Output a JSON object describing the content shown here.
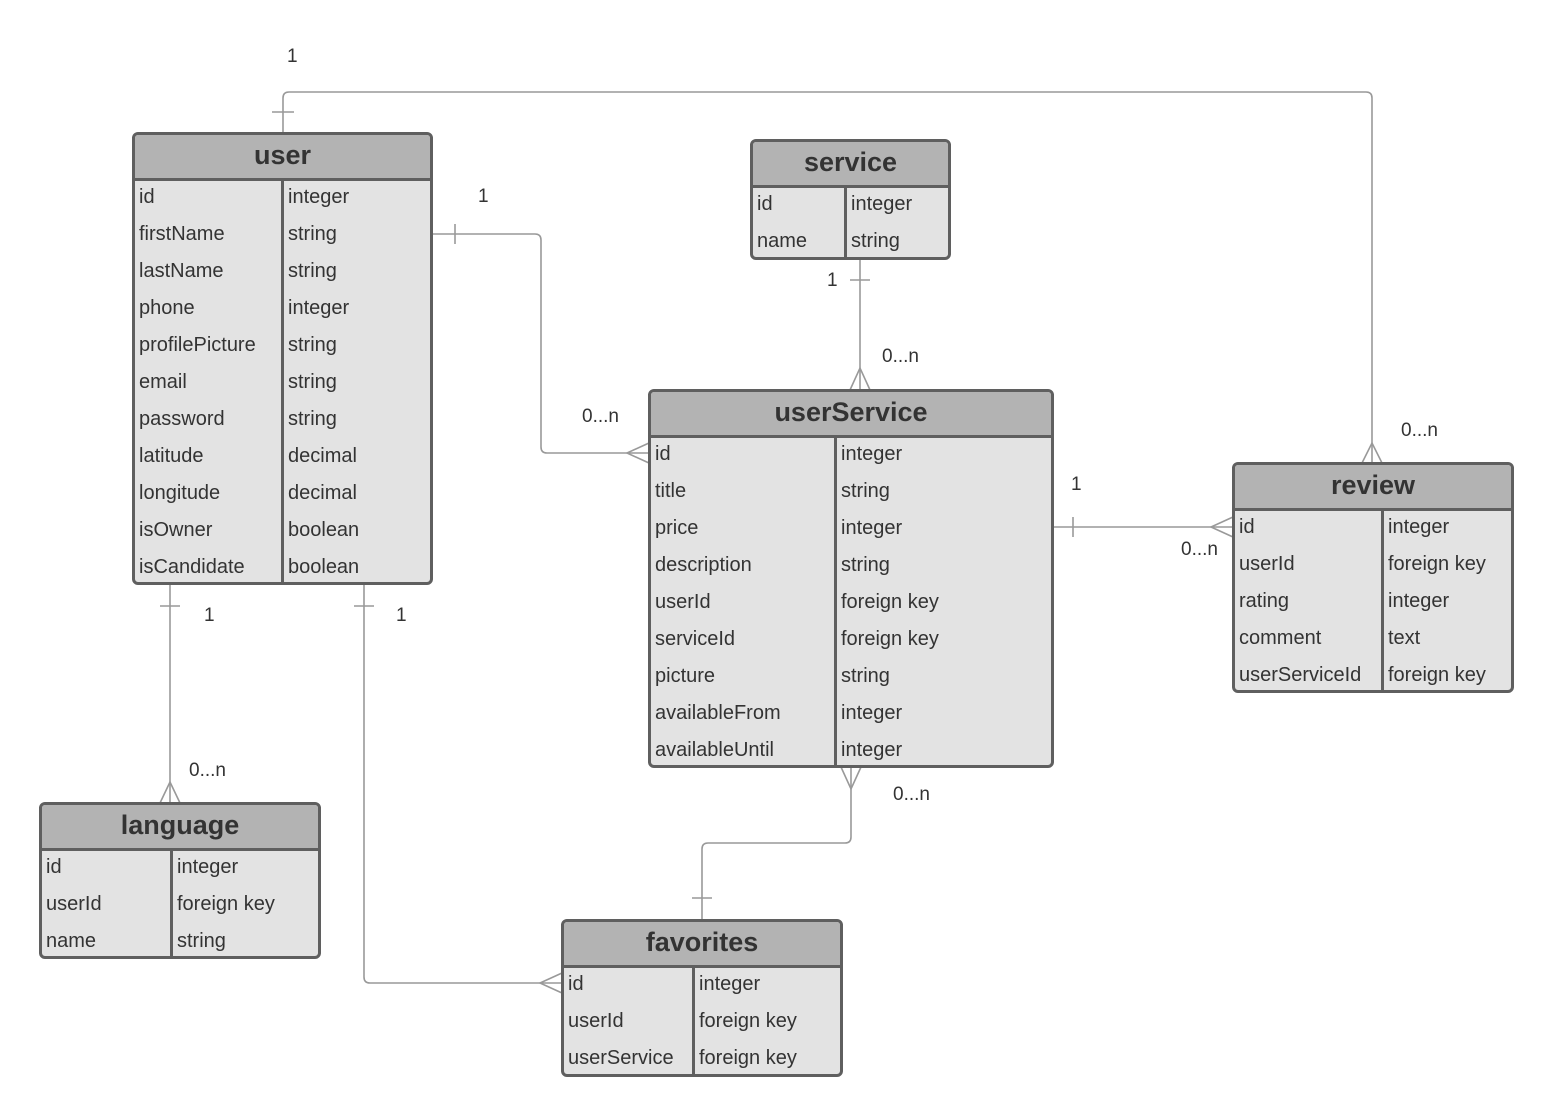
{
  "colors": {
    "header_fill": "#b3b3b3",
    "body_fill": "#e3e3e3",
    "border": "#5f5f5f",
    "connector": "#999999",
    "text": "#333333"
  },
  "entities": {
    "user": {
      "title": "user",
      "rows": [
        {
          "name": "id",
          "type": "integer"
        },
        {
          "name": "firstName",
          "type": "string"
        },
        {
          "name": "lastName",
          "type": "string"
        },
        {
          "name": "phone",
          "type": "integer"
        },
        {
          "name": "profilePicture",
          "type": "string"
        },
        {
          "name": "email",
          "type": "string"
        },
        {
          "name": "password",
          "type": "string"
        },
        {
          "name": "latitude",
          "type": "decimal"
        },
        {
          "name": "longitude",
          "type": "decimal"
        },
        {
          "name": "isOwner",
          "type": "boolean"
        },
        {
          "name": "isCandidate",
          "type": "boolean"
        }
      ]
    },
    "service": {
      "title": "service",
      "rows": [
        {
          "name": "id",
          "type": "integer"
        },
        {
          "name": "name",
          "type": "string"
        }
      ]
    },
    "userService": {
      "title": "userService",
      "rows": [
        {
          "name": "id",
          "type": "integer"
        },
        {
          "name": "title",
          "type": "string"
        },
        {
          "name": "price",
          "type": "integer"
        },
        {
          "name": "description",
          "type": "string"
        },
        {
          "name": "userId",
          "type": "foreign key"
        },
        {
          "name": "serviceId",
          "type": "foreign key"
        },
        {
          "name": "picture",
          "type": "string"
        },
        {
          "name": "availableFrom",
          "type": "integer"
        },
        {
          "name": "availableUntil",
          "type": "integer"
        }
      ]
    },
    "review": {
      "title": "review",
      "rows": [
        {
          "name": "id",
          "type": "integer"
        },
        {
          "name": "userId",
          "type": "foreign key"
        },
        {
          "name": "rating",
          "type": "integer"
        },
        {
          "name": "comment",
          "type": "text"
        },
        {
          "name": "userServiceId",
          "type": "foreign key"
        }
      ]
    },
    "language": {
      "title": "language",
      "rows": [
        {
          "name": "id",
          "type": "integer"
        },
        {
          "name": "userId",
          "type": "foreign key"
        },
        {
          "name": "name",
          "type": "string"
        }
      ]
    },
    "favorites": {
      "title": "favorites",
      "rows": [
        {
          "name": "id",
          "type": "integer"
        },
        {
          "name": "userId",
          "type": "foreign key"
        },
        {
          "name": "userService",
          "type": "foreign key"
        }
      ]
    }
  },
  "relationships": [
    {
      "from": "user",
      "to": "review",
      "from_cardinality": "1",
      "to_cardinality": "0...n"
    },
    {
      "from": "user",
      "to": "userService",
      "from_cardinality": "1",
      "to_cardinality": "0...n"
    },
    {
      "from": "service",
      "to": "userService",
      "from_cardinality": "1",
      "to_cardinality": "0...n"
    },
    {
      "from": "userService",
      "to": "review",
      "from_cardinality": "1",
      "to_cardinality": "0...n"
    },
    {
      "from": "user",
      "to": "language",
      "from_cardinality": "1",
      "to_cardinality": "0...n"
    },
    {
      "from": "user",
      "to": "favorites",
      "from_cardinality": "1",
      "to_cardinality": "0...n"
    },
    {
      "from": "favorites",
      "to": "userService",
      "from_cardinality": "",
      "to_cardinality": "0...n"
    }
  ]
}
